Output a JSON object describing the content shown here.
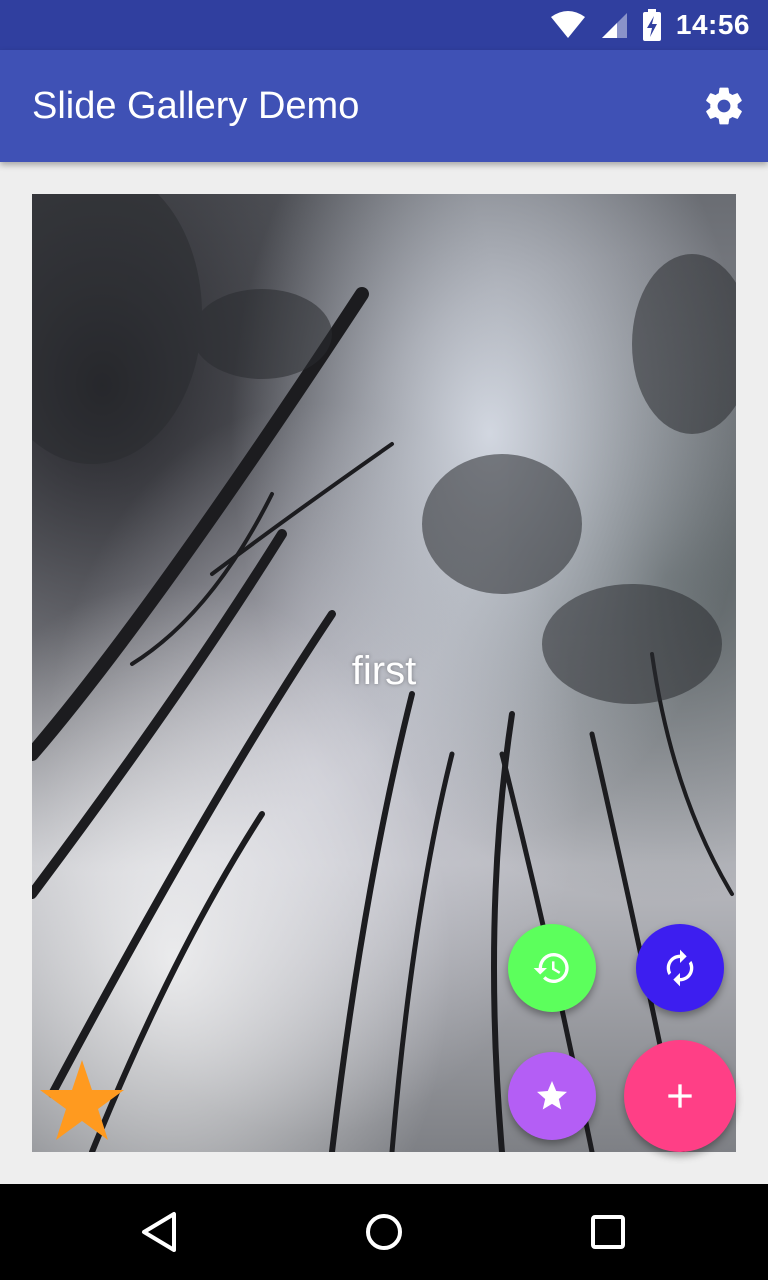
{
  "status_bar": {
    "time": "14:56",
    "icons": [
      "wifi-icon",
      "cellular-signal-icon",
      "battery-charging-icon"
    ]
  },
  "app_bar": {
    "title": "Slide Gallery Demo",
    "action_icon": "settings-gear-icon"
  },
  "gallery": {
    "slide_label": "first",
    "favorite_icon": "star-icon",
    "colors": {
      "favorite_star": "#ff9a1f"
    }
  },
  "fab_menu": {
    "buttons": [
      {
        "name": "history",
        "icon": "history-icon",
        "color": "#5cff5c"
      },
      {
        "name": "refresh",
        "icon": "refresh-icon",
        "color": "#3d1ef0"
      },
      {
        "name": "favorite",
        "icon": "star-icon",
        "color": "#b45ef5"
      },
      {
        "name": "add",
        "icon": "plus-icon",
        "color": "#ff3f86"
      }
    ]
  },
  "nav_bar": {
    "buttons": [
      "back-icon",
      "home-icon",
      "recents-icon"
    ]
  },
  "colors": {
    "status_bar": "#303f9f",
    "app_bar": "#3f51b5",
    "background": "#eeeeee"
  }
}
